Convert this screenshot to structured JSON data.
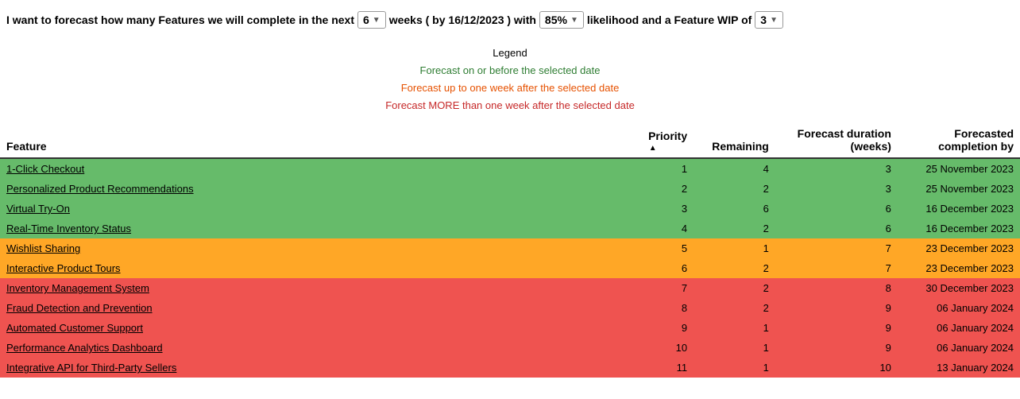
{
  "topBar": {
    "prefix": "I want to forecast how many Features we will complete in the next",
    "weeks_value": "6",
    "weeks_label": "weeks ( by 16/12/2023 ) with",
    "likelihood_value": "85%",
    "likelihood_suffix": "likelihood and a Feature WIP of",
    "wip_value": "3"
  },
  "legend": {
    "title": "Legend",
    "green": "Forecast on or before the selected date",
    "orange": "Forecast up to one week after the selected date",
    "red": "Forecast MORE than one week after the selected date"
  },
  "table": {
    "headers": {
      "feature": "Feature",
      "priority": "Priority",
      "remaining": "Remaining",
      "forecast_duration": "Forecast duration (weeks)",
      "forecasted_completion": "Forecasted completion by"
    },
    "rows": [
      {
        "name": "1-Click Checkout",
        "priority": 1,
        "remaining": 4,
        "forecast_duration": 3,
        "completion": "25 November 2023",
        "color": "green"
      },
      {
        "name": "Personalized Product Recommendations",
        "priority": 2,
        "remaining": 2,
        "forecast_duration": 3,
        "completion": "25 November 2023",
        "color": "green"
      },
      {
        "name": "Virtual Try-On",
        "priority": 3,
        "remaining": 6,
        "forecast_duration": 6,
        "completion": "16 December 2023",
        "color": "green"
      },
      {
        "name": "Real-Time Inventory Status",
        "priority": 4,
        "remaining": 2,
        "forecast_duration": 6,
        "completion": "16 December 2023",
        "color": "green"
      },
      {
        "name": "Wishlist Sharing",
        "priority": 5,
        "remaining": 1,
        "forecast_duration": 7,
        "completion": "23 December 2023",
        "color": "orange"
      },
      {
        "name": "Interactive Product Tours",
        "priority": 6,
        "remaining": 2,
        "forecast_duration": 7,
        "completion": "23 December 2023",
        "color": "orange"
      },
      {
        "name": "Inventory Management System",
        "priority": 7,
        "remaining": 2,
        "forecast_duration": 8,
        "completion": "30 December 2023",
        "color": "red"
      },
      {
        "name": "Fraud Detection and Prevention",
        "priority": 8,
        "remaining": 2,
        "forecast_duration": 9,
        "completion": "06 January 2024",
        "color": "red"
      },
      {
        "name": "Automated Customer Support",
        "priority": 9,
        "remaining": 1,
        "forecast_duration": 9,
        "completion": "06 January 2024",
        "color": "red"
      },
      {
        "name": "Performance Analytics Dashboard",
        "priority": 10,
        "remaining": 1,
        "forecast_duration": 9,
        "completion": "06 January 2024",
        "color": "red"
      },
      {
        "name": "Integrative API for Third-Party Sellers",
        "priority": 11,
        "remaining": 1,
        "forecast_duration": 10,
        "completion": "13 January 2024",
        "color": "red"
      }
    ]
  },
  "colors": {
    "green": "#66bb6a",
    "orange": "#ffa726",
    "red": "#ef5350"
  }
}
